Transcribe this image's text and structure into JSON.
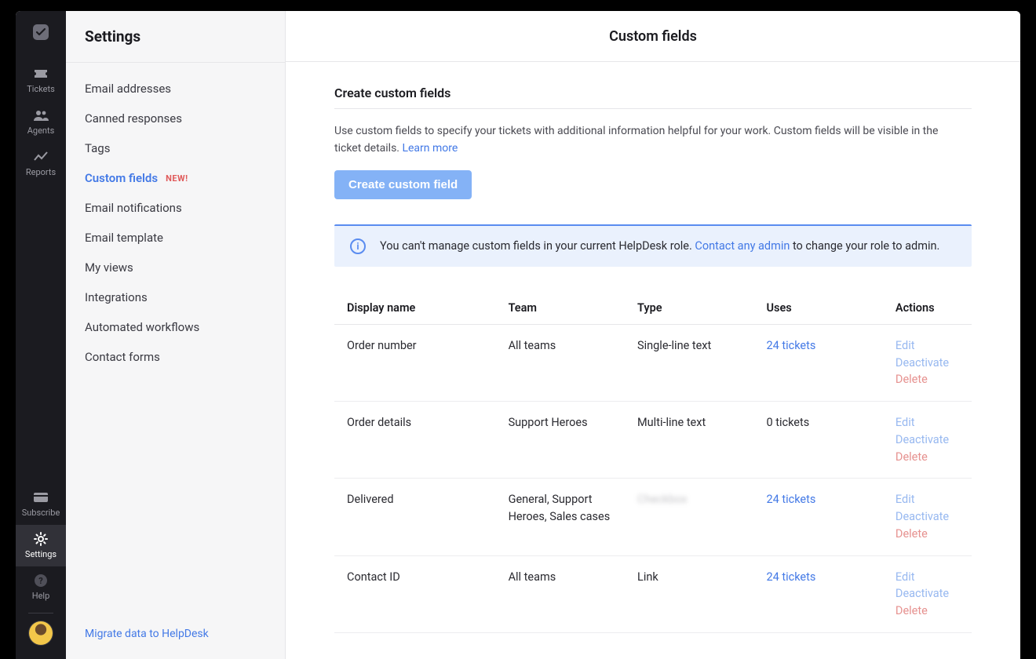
{
  "rail": {
    "items": [
      {
        "id": "tickets",
        "label": "Tickets"
      },
      {
        "id": "agents",
        "label": "Agents"
      },
      {
        "id": "reports",
        "label": "Reports"
      }
    ],
    "bottom": [
      {
        "id": "subscribe",
        "label": "Subscribe"
      },
      {
        "id": "settings",
        "label": "Settings"
      },
      {
        "id": "help",
        "label": "Help"
      }
    ],
    "active": "settings"
  },
  "sidebar": {
    "title": "Settings",
    "items": [
      {
        "label": "Email addresses"
      },
      {
        "label": "Canned responses"
      },
      {
        "label": "Tags"
      },
      {
        "label": "Custom fields",
        "active": true,
        "badge": "NEW!"
      },
      {
        "label": "Email notifications"
      },
      {
        "label": "Email template"
      },
      {
        "label": "My views"
      },
      {
        "label": "Integrations"
      },
      {
        "label": "Automated workflows"
      },
      {
        "label": "Contact forms"
      }
    ],
    "footer_link": "Migrate data to HelpDesk"
  },
  "main": {
    "header": "Custom fields",
    "section_title": "Create custom fields",
    "description": "Use custom fields to specify your tickets with additional information helpful for your work. Custom fields will be visible in the ticket details. ",
    "learn_more": "Learn more",
    "create_button": "Create custom field",
    "notice": {
      "pre": "You can't manage custom fields in your current HelpDesk role. ",
      "link": "Contact any admin",
      "post": " to change your role to admin."
    },
    "table": {
      "headers": {
        "name": "Display name",
        "team": "Team",
        "type": "Type",
        "uses": "Uses",
        "actions": "Actions"
      },
      "action_labels": {
        "edit": "Edit",
        "deactivate": "Deactivate",
        "delete": "Delete"
      },
      "rows": [
        {
          "name": "Order number",
          "team": "All teams",
          "type": "Single-line text",
          "uses": "24 tickets",
          "uses_link": true
        },
        {
          "name": "Order details",
          "team": "Support Heroes",
          "type": "Multi-line text",
          "uses": "0 tickets",
          "uses_link": false
        },
        {
          "name": "Delivered",
          "team": "General, Support Heroes, Sales cases",
          "type": "Checkbox",
          "type_blurred": true,
          "uses": "24 tickets",
          "uses_link": true
        },
        {
          "name": "Contact ID",
          "team": "All teams",
          "type": "Link",
          "uses": "24 tickets",
          "uses_link": true
        }
      ]
    }
  }
}
